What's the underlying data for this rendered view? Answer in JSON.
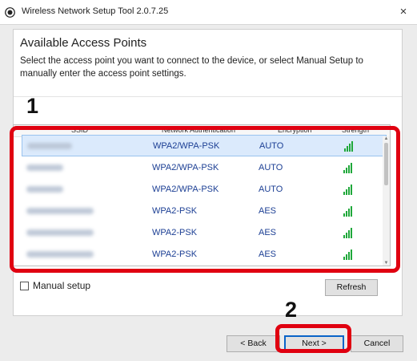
{
  "window": {
    "title": "Wireless Network Setup Tool 2.0.7.25",
    "close_glyph": "×"
  },
  "header": {
    "heading": "Available Access Points",
    "description": "Select the access point you want to connect to the device, or select Manual Setup to manually enter the access point settings."
  },
  "table": {
    "columns": [
      "SSID",
      "Network Authentication",
      "Encryption",
      "Strength"
    ],
    "rows": [
      {
        "ssid": "",
        "auth": "WPA2/WPA-PSK",
        "enc": "AUTO",
        "signal": "signal-strength-icon",
        "selected": true
      },
      {
        "ssid": "",
        "auth": "WPA2/WPA-PSK",
        "enc": "AUTO",
        "signal": "signal-strength-icon",
        "selected": false
      },
      {
        "ssid": "",
        "auth": "WPA2/WPA-PSK",
        "enc": "AUTO",
        "signal": "signal-strength-icon",
        "selected": false
      },
      {
        "ssid": "",
        "auth": "WPA2-PSK",
        "enc": "AES",
        "signal": "signal-strength-icon",
        "selected": false
      },
      {
        "ssid": "",
        "auth": "WPA2-PSK",
        "enc": "AES",
        "signal": "signal-strength-icon",
        "selected": false
      },
      {
        "ssid": "",
        "auth": "WPA2-PSK",
        "enc": "AES",
        "signal": "signal-strength-icon",
        "selected": false
      }
    ]
  },
  "manual_setup": {
    "label": "Manual setup",
    "checked": false
  },
  "buttons": {
    "refresh": "Refresh",
    "back": "< Back",
    "next": "Next >",
    "cancel": "Cancel"
  },
  "annotations": {
    "step1": "1",
    "step2": "2"
  },
  "colors": {
    "highlight": "#e00010",
    "signal": "#1fa83a",
    "link_text": "#1c3f94",
    "selection": "#dbeafc"
  }
}
